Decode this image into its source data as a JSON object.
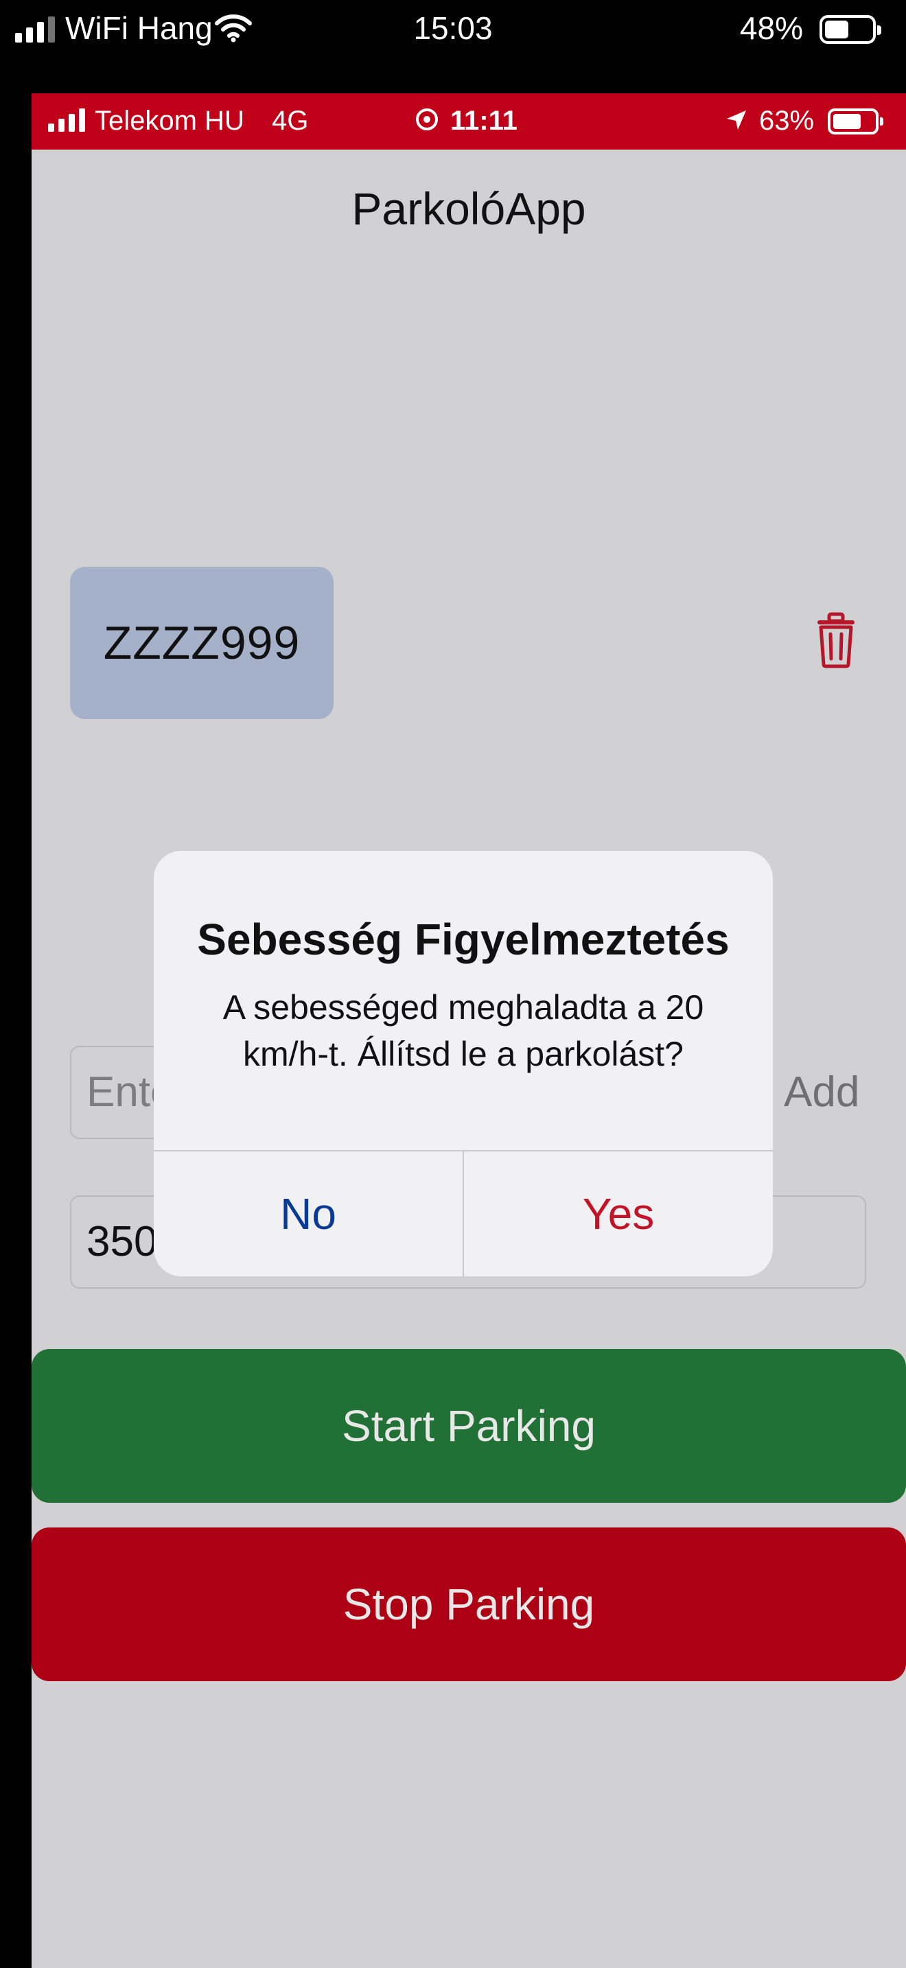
{
  "outer_status": {
    "carrier": "WiFi Hang",
    "time": "15:03",
    "battery": "48%"
  },
  "inner_status": {
    "carrier": "Telekom HU",
    "network": "4G",
    "time": "11:11",
    "battery": "63%"
  },
  "app": {
    "title": "ParkolóApp"
  },
  "plates": [
    {
      "label": "ZZZZ999"
    }
  ],
  "form": {
    "plate_placeholder": "Ente",
    "add_label": "Add",
    "amount_value": "350"
  },
  "actions": {
    "start_label": "Start Parking",
    "stop_label": "Stop Parking"
  },
  "alert": {
    "title": "Sebesség Figyelmeztetés",
    "message": "A sebességed meghaladta a 20 km/h-t. Állítsd le a parkolást?",
    "no_label": "No",
    "yes_label": "Yes"
  },
  "colors": {
    "header_red": "#c00018",
    "start_green": "#217035",
    "stop_red": "#ad0014",
    "plate_blue": "#a4b1c9",
    "alert_no": "#0b3a94",
    "alert_yes": "#c21426"
  },
  "icons": [
    "signal-icon",
    "wifi-icon",
    "battery-icon",
    "record-icon",
    "location-arrow-icon",
    "trash-icon"
  ]
}
